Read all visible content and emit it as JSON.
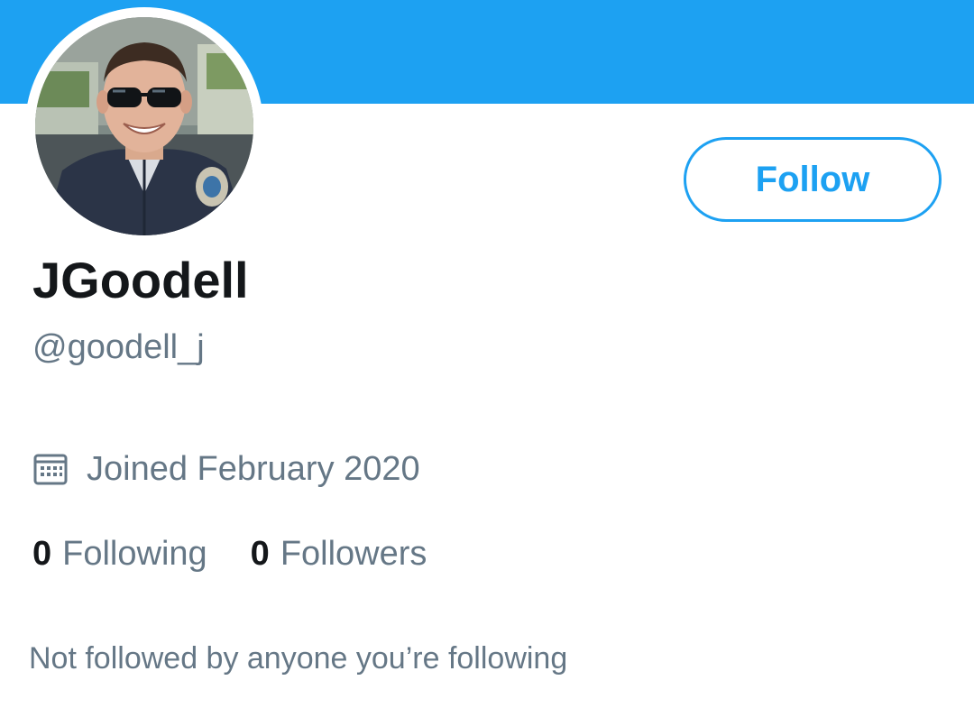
{
  "colors": {
    "accent": "#1da1f2",
    "primary_text": "#14171a",
    "secondary_text": "#657786"
  },
  "profile": {
    "display_name": "JGoodell",
    "handle": "@goodell_j",
    "avatar_icon": "profile-photo",
    "joined_icon": "calendar-icon",
    "joined": "Joined February 2020",
    "following_count": "0",
    "following_label": "Following",
    "followers_count": "0",
    "followers_label": "Followers",
    "mutual_note": "Not followed by anyone you’re following"
  },
  "actions": {
    "follow_label": "Follow"
  }
}
